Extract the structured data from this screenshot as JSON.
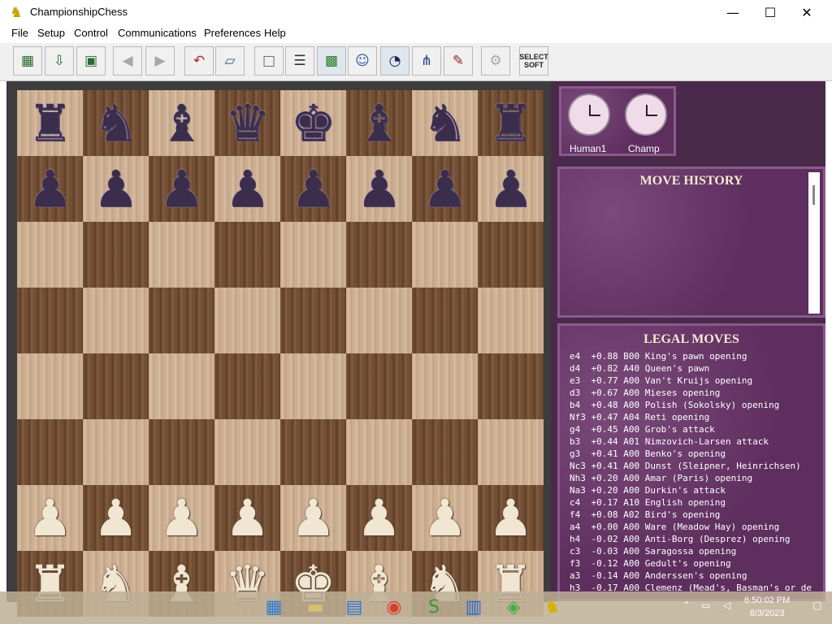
{
  "window": {
    "title": "ChampionshipChess",
    "minimize": "—",
    "maximize": "☐",
    "close": "✕"
  },
  "menu": [
    {
      "id": "file",
      "label": "File"
    },
    {
      "id": "setup",
      "label": "Setup"
    },
    {
      "id": "control",
      "label": "Control"
    },
    {
      "id": "communications",
      "label": "Communications"
    },
    {
      "id": "preferences",
      "label": "Preferences"
    },
    {
      "id": "help",
      "label": "Help"
    }
  ],
  "toolbar": {
    "new_game_icon": "board-icon",
    "open_icon": "open-icon",
    "save_icon": "save-icon",
    "back_icon": "back-arrow-icon",
    "forward_icon": "forward-arrow-icon",
    "undo_icon": "undo-icon",
    "flip_icon": "flip-board-icon",
    "blank_icon": "blank-board-icon",
    "notation_icon": "notation-list-icon",
    "board3d_icon": "board-view-icon",
    "head_icon": "head-icon",
    "clocks_icon": "clocks-icon",
    "analysis_icon": "analysis-icon",
    "hint_icon": "hint-icon",
    "settings_icon": "settings-icon",
    "select_soft_label": "SELECT SOFT"
  },
  "board": {
    "rows": [
      [
        {
          "piece": "♜",
          "color": "black"
        },
        {
          "piece": "♞",
          "color": "black"
        },
        {
          "piece": "♝",
          "color": "black"
        },
        {
          "piece": "♛",
          "color": "black"
        },
        {
          "piece": "♚",
          "color": "black"
        },
        {
          "piece": "♝",
          "color": "black"
        },
        {
          "piece": "♞",
          "color": "black"
        },
        {
          "piece": "♜",
          "color": "black"
        }
      ],
      [
        {
          "piece": "♟",
          "color": "black"
        },
        {
          "piece": "♟",
          "color": "black"
        },
        {
          "piece": "♟",
          "color": "black"
        },
        {
          "piece": "♟",
          "color": "black"
        },
        {
          "piece": "♟",
          "color": "black"
        },
        {
          "piece": "♟",
          "color": "black"
        },
        {
          "piece": "♟",
          "color": "black"
        },
        {
          "piece": "♟",
          "color": "black"
        }
      ],
      [
        {},
        {},
        {},
        {},
        {},
        {},
        {},
        {}
      ],
      [
        {},
        {},
        {},
        {},
        {},
        {},
        {},
        {}
      ],
      [
        {},
        {},
        {},
        {},
        {},
        {},
        {},
        {}
      ],
      [
        {},
        {},
        {},
        {},
        {},
        {},
        {},
        {}
      ],
      [
        {
          "piece": "♟",
          "color": "white"
        },
        {
          "piece": "♟",
          "color": "white"
        },
        {
          "piece": "♟",
          "color": "white"
        },
        {
          "piece": "♟",
          "color": "white"
        },
        {
          "piece": "♟",
          "color": "white"
        },
        {
          "piece": "♟",
          "color": "white"
        },
        {
          "piece": "♟",
          "color": "white"
        },
        {
          "piece": "♟",
          "color": "white"
        }
      ],
      [
        {
          "piece": "♜",
          "color": "white"
        },
        {
          "piece": "♞",
          "color": "white"
        },
        {
          "piece": "♝",
          "color": "white"
        },
        {
          "piece": "♛",
          "color": "white"
        },
        {
          "piece": "♚",
          "color": "white"
        },
        {
          "piece": "♝",
          "color": "white"
        },
        {
          "piece": "♞",
          "color": "white"
        },
        {
          "piece": "♜",
          "color": "white"
        }
      ]
    ]
  },
  "clocks": {
    "player1": {
      "label": "Human1"
    },
    "player2": {
      "label": "Champ"
    }
  },
  "move_history": {
    "title": "MOVE HISTORY"
  },
  "legal_moves": {
    "title": "LEGAL MOVES",
    "items": [
      "e4  +0.88 B00 King's pawn opening",
      "d4  +0.82 A40 Queen's pawn",
      "e3  +0.77 A00 Van't Kruijs opening",
      "d3  +0.67 A00 Mieses opening",
      "b4  +0.48 A00 Polish (Sokolsky) opening",
      "Nf3 +0.47 A04 Reti opening",
      "g4  +0.45 A00 Grob's attack",
      "b3  +0.44 A01 Nimzovich-Larsen attack",
      "g3  +0.41 A00 Benko's opening",
      "Nc3 +0.41 A00 Dunst (Sleipner, Heinrichsen)",
      "Nh3 +0.20 A00 Amar (Paris) opening",
      "Na3 +0.20 A00 Durkin's attack",
      "c4  +0.17 A10 English opening",
      "f4  +0.08 A02 Bird's opening",
      "a4  +0.00 A00 Ware (Meadow Hay) opening",
      "h4  -0.02 A00 Anti-Borg (Desprez) opening",
      "c3  -0.03 A00 Saragossa opening",
      "f3  -0.12 A00 Gedult's opening",
      "a3  -0.14 A00 Anderssen's opening",
      "h3  -0.17 A00 Clemenz (Mead's, Basman's or de"
    ]
  },
  "taskbar": {
    "time": "6:50:02 PM",
    "date": "8/3/2023",
    "apps": [
      "start-icon",
      "file-explorer-icon",
      "store-icon",
      "chrome-icon",
      "app-s-icon",
      "notepad-icon",
      "dice-icon",
      "chess-app-icon"
    ]
  }
}
